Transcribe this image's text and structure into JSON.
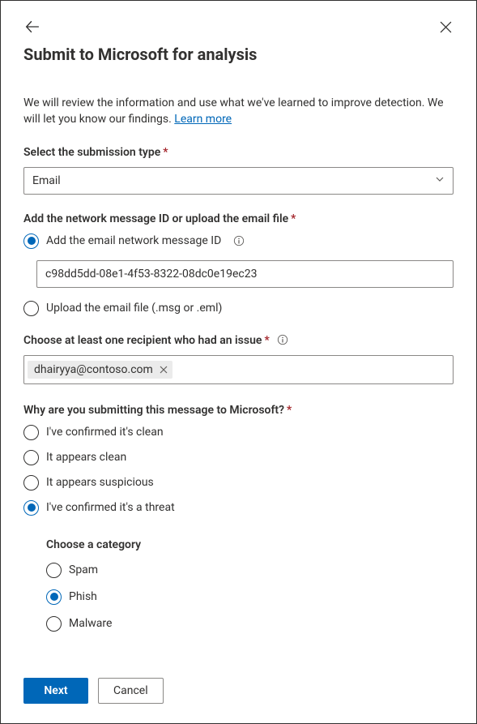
{
  "title": "Submit to Microsoft for analysis",
  "intro_text": "We will review the information and use what we've learned to improve detection. We will let you know our findings. ",
  "learn_more": "Learn more",
  "submission_type": {
    "label": "Select the submission type",
    "value": "Email"
  },
  "message_id_section": {
    "label": "Add the network message ID or upload the email file",
    "option_add_id": "Add the email network message ID",
    "option_upload": "Upload the email file (.msg or .eml)",
    "selected": "add_id",
    "message_id_value": "c98dd5dd-08e1-4f53-8322-08dc0e19ec23"
  },
  "recipient_section": {
    "label": "Choose at least one recipient who had an issue",
    "chip_value": "dhairyya@contoso.com"
  },
  "reason_section": {
    "label": "Why are you submitting this message to Microsoft?",
    "options": [
      {
        "key": "confirmed_clean",
        "label": "I've confirmed it's clean"
      },
      {
        "key": "appears_clean",
        "label": "It appears clean"
      },
      {
        "key": "appears_suspicious",
        "label": "It appears suspicious"
      },
      {
        "key": "confirmed_threat",
        "label": "I've confirmed it's a threat"
      }
    ],
    "selected": "confirmed_threat",
    "category_label": "Choose a category",
    "categories": [
      {
        "key": "spam",
        "label": "Spam"
      },
      {
        "key": "phish",
        "label": "Phish"
      },
      {
        "key": "malware",
        "label": "Malware"
      }
    ],
    "category_selected": "phish"
  },
  "footer": {
    "next": "Next",
    "cancel": "Cancel"
  }
}
